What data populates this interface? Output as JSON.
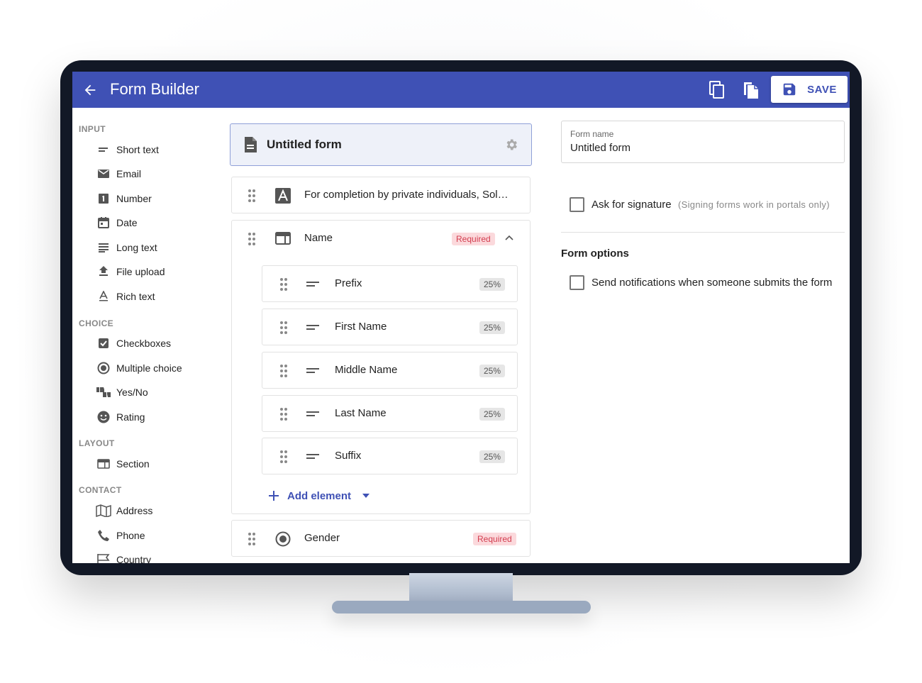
{
  "appbar": {
    "title": "Form Builder",
    "save_label": "SAVE"
  },
  "sidebar": {
    "sections": [
      {
        "heading": "INPUT",
        "items": [
          {
            "label": "Short text",
            "icon": "short-text-icon"
          },
          {
            "label": "Email",
            "icon": "email-icon"
          },
          {
            "label": "Number",
            "icon": "number-icon"
          },
          {
            "label": "Date",
            "icon": "date-icon"
          },
          {
            "label": "Long text",
            "icon": "long-text-icon"
          },
          {
            "label": "File upload",
            "icon": "file-upload-icon"
          },
          {
            "label": "Rich text",
            "icon": "rich-text-icon"
          }
        ]
      },
      {
        "heading": "CHOICE",
        "items": [
          {
            "label": "Checkboxes",
            "icon": "checkbox-icon"
          },
          {
            "label": "Multiple choice",
            "icon": "radio-icon"
          },
          {
            "label": "Yes/No",
            "icon": "thumbs-icon"
          },
          {
            "label": "Rating",
            "icon": "smiley-icon"
          }
        ]
      },
      {
        "heading": "LAYOUT",
        "items": [
          {
            "label": "Section",
            "icon": "section-icon"
          }
        ]
      },
      {
        "heading": "CONTACT",
        "items": [
          {
            "label": "Address",
            "icon": "map-icon"
          },
          {
            "label": "Phone",
            "icon": "phone-icon"
          },
          {
            "label": "Country",
            "icon": "flag-icon"
          }
        ]
      }
    ]
  },
  "form": {
    "title": "Untitled form",
    "elements": [
      {
        "label": "For completion by private individuals, Sol…",
        "icon": "text-block-icon"
      },
      {
        "label": "Name",
        "icon": "section-icon",
        "badge": "Required",
        "children": [
          {
            "label": "Prefix",
            "width": "25%"
          },
          {
            "label": "First Name",
            "width": "25%"
          },
          {
            "label": "Middle Name",
            "width": "25%"
          },
          {
            "label": "Last Name",
            "width": "25%"
          },
          {
            "label": "Suffix",
            "width": "25%"
          }
        ]
      },
      {
        "label": "Gender",
        "icon": "radio-icon",
        "badge": "Required"
      }
    ],
    "add_element_label": "Add element"
  },
  "settings": {
    "form_name_label": "Form name",
    "form_name_value": "Untitled form",
    "signature_label": "Ask for signature",
    "signature_hint": "(Signing forms work in portals only)",
    "options_title": "Form options",
    "notify_label": "Send notifications when someone submits the form"
  },
  "colors": {
    "primary": "#3f51b5",
    "required_bg": "#fbd9dc",
    "required_text": "#d33d4f"
  }
}
